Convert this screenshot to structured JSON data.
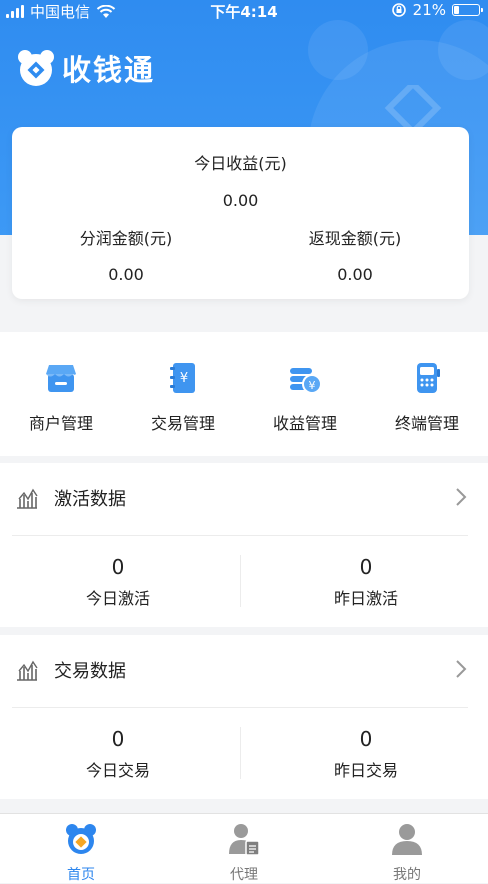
{
  "status_bar": {
    "carrier": "中国电信",
    "time": "下午4:14",
    "battery": "21%"
  },
  "brand": {
    "title": "收钱通"
  },
  "earnings": {
    "today_label": "今日收益(元)",
    "today_value": "0.00",
    "profit_label": "分润金额(元)",
    "profit_value": "0.00",
    "cashback_label": "返现金额(元)",
    "cashback_value": "0.00"
  },
  "functions": [
    {
      "label": "商户管理",
      "icon": "store-icon"
    },
    {
      "label": "交易管理",
      "icon": "yuan-book-icon"
    },
    {
      "label": "收益管理",
      "icon": "coins-icon"
    },
    {
      "label": "终端管理",
      "icon": "pos-terminal-icon"
    }
  ],
  "activation": {
    "title": "激活数据",
    "today_value": "0",
    "today_label": "今日激活",
    "yesterday_value": "0",
    "yesterday_label": "昨日激活"
  },
  "transactions": {
    "title": "交易数据",
    "today_value": "0",
    "today_label": "今日交易",
    "yesterday_value": "0",
    "yesterday_label": "昨日交易"
  },
  "tabbar": {
    "items": [
      {
        "label": "首页",
        "icon": "home-mascot-icon",
        "active": true
      },
      {
        "label": "代理",
        "icon": "agent-icon",
        "active": false
      },
      {
        "label": "我的",
        "icon": "profile-icon",
        "active": false
      }
    ]
  },
  "colors": {
    "primary": "#2f8cf0",
    "background": "#f3f4f6",
    "active_tab": "#2d86ee"
  }
}
